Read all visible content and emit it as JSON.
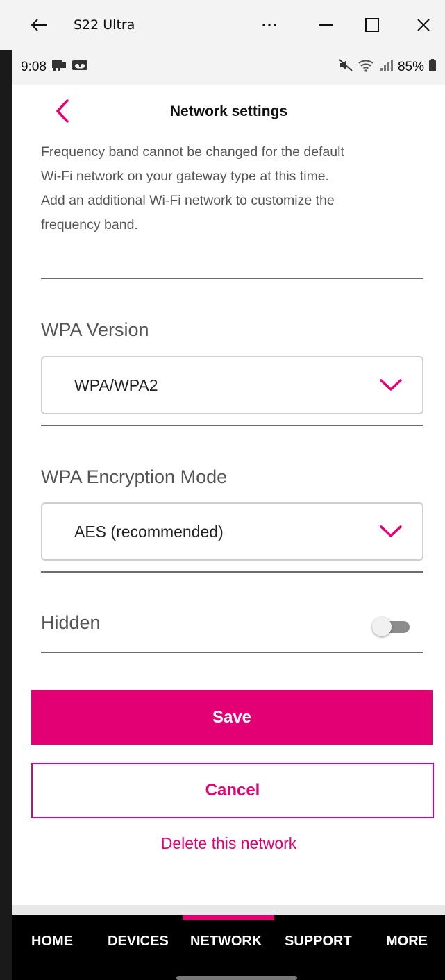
{
  "window": {
    "title": "S22 Ultra",
    "icons": [
      "back-arrow-icon",
      "more-icon",
      "minimize-icon",
      "maximize-icon",
      "close-icon"
    ]
  },
  "statusbar": {
    "time": "9:08",
    "battery": "85%",
    "icons": [
      "notification-icon",
      "voicemail-icon",
      "mute-icon",
      "wifi-icon",
      "signal-icon",
      "battery-icon"
    ]
  },
  "header": {
    "title": "Network settings"
  },
  "note": {
    "line1": "Frequency band cannot be changed for the default",
    "line2": "Wi-Fi network on your gateway type at this time.",
    "line3": "Add an additional Wi-Fi network to customize the",
    "line4": "frequency band."
  },
  "wpa_version": {
    "label": "WPA Version",
    "value": "WPA/WPA2"
  },
  "wpa_encryption": {
    "label": "WPA Encryption Mode",
    "value": "AES (recommended)"
  },
  "hidden": {
    "label": "Hidden",
    "enabled": false
  },
  "actions": {
    "save": "Save",
    "cancel": "Cancel",
    "delete": "Delete this network"
  },
  "nav": {
    "items": [
      "HOME",
      "DEVICES",
      "NETWORK",
      "SUPPORT",
      "MORE"
    ],
    "active": "NETWORK"
  },
  "colors": {
    "accent": "#e20074",
    "nav_bg": "#000000",
    "text_muted": "#555555"
  }
}
